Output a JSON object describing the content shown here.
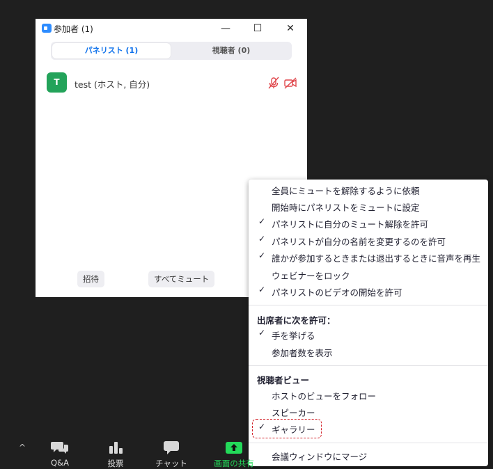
{
  "window": {
    "title": "参加者 (1)",
    "controls": {
      "minimize": "—",
      "maximize": "☐",
      "close": "✕"
    },
    "tabs": [
      {
        "label": "パネリスト (1)"
      },
      {
        "label": "視聴者 (0)"
      }
    ],
    "participant": {
      "initial": "T",
      "name": "test (ホスト, 自分)"
    },
    "buttons": {
      "invite": "招待",
      "mute_all": "すべてミュート"
    }
  },
  "menu": {
    "items": [
      {
        "label": "全員にミュートを解除するように依頼",
        "checked": false
      },
      {
        "label": "開始時にパネリストをミュートに設定",
        "checked": false
      },
      {
        "label": "パネリストに自分のミュート解除を許可",
        "checked": true
      },
      {
        "label": "パネリストが自分の名前を変更するのを許可",
        "checked": true
      },
      {
        "label": "誰かが参加するときまたは退出するときに音声を再生",
        "checked": true
      },
      {
        "label": "ウェビナーをロック",
        "checked": false
      },
      {
        "label": "パネリストのビデオの開始を許可",
        "checked": true
      }
    ],
    "attendee_header": "出席者に次を許可：",
    "attendee_items": [
      {
        "label": "手を挙げる",
        "checked": true
      },
      {
        "label": "参加者数を表示",
        "checked": false
      }
    ],
    "view_header": "視聴者ビュー",
    "view_items": [
      {
        "label": "ホストのビューをフォロー",
        "checked": false
      },
      {
        "label": "スピーカー",
        "checked": false
      },
      {
        "label": "ギャラリー",
        "checked": true
      }
    ],
    "merge": {
      "label": "会議ウィンドウにマージ"
    },
    "check_glyph": "✓"
  },
  "toolbar": {
    "items": [
      {
        "label": "Q&A"
      },
      {
        "label": "投票"
      },
      {
        "label": "チャット"
      },
      {
        "label": "画面の共有"
      }
    ],
    "caret": "^"
  },
  "colors": {
    "accent_blue": "#0e71eb",
    "avatar_green": "#23a35a",
    "muted_red": "#e0474c",
    "share_green": "#23d959",
    "highlight_red": "#d2232a"
  }
}
